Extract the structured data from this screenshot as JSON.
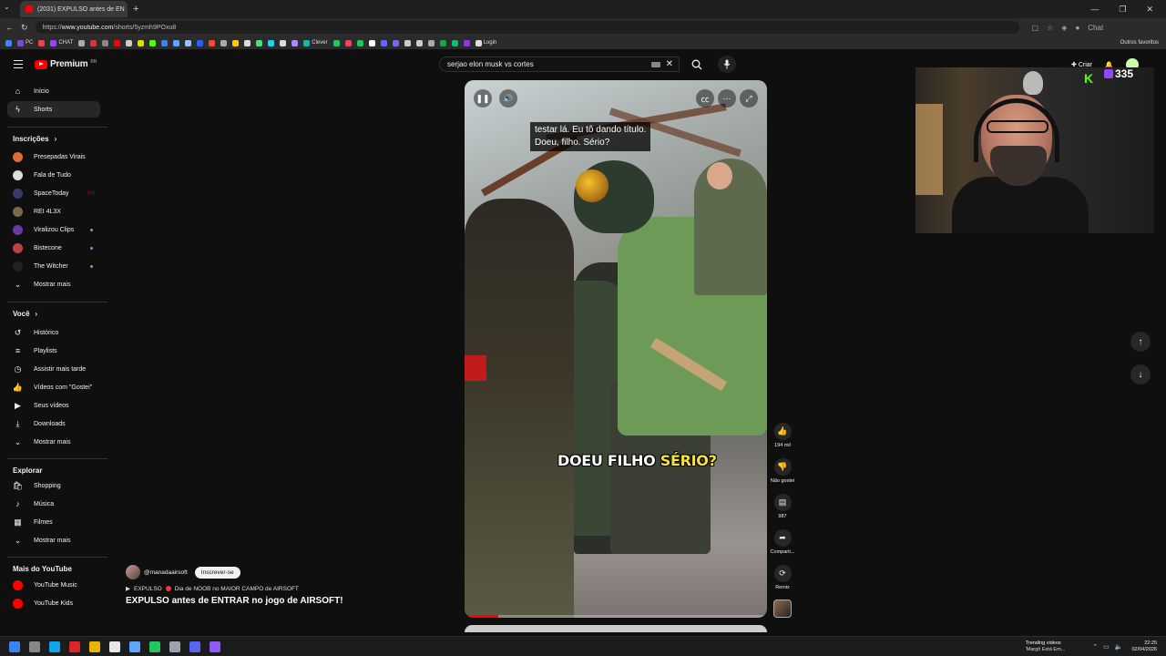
{
  "browser": {
    "tab_title": "(2031) EXPULSO antes de EN",
    "url_prefix": "https://",
    "url_host": "www.youtube.com",
    "url_path": "/shorts/5yzmh9POxu8",
    "bookmarks": [
      {
        "label": "",
        "color": "#4285f4"
      },
      {
        "label": "PC",
        "color": "#7b4bd6"
      },
      {
        "label": "",
        "color": "#e44"
      },
      {
        "label": "CHAT",
        "color": "#9146ff"
      },
      {
        "label": "",
        "color": "#aaa"
      },
      {
        "label": "",
        "color": "#d33"
      },
      {
        "label": "",
        "color": "#888"
      },
      {
        "label": "",
        "color": "#f00"
      },
      {
        "label": "",
        "color": "#ccc"
      },
      {
        "label": "",
        "color": "#dd0"
      },
      {
        "label": "",
        "color": "#53fc18"
      },
      {
        "label": "",
        "color": "#3b82f6"
      },
      {
        "label": "",
        "color": "#60a5fa"
      },
      {
        "label": "",
        "color": "#93c5fd"
      },
      {
        "label": "",
        "color": "#2563eb"
      },
      {
        "label": "",
        "color": "#f43"
      },
      {
        "label": "",
        "color": "#aaa"
      },
      {
        "label": "",
        "color": "#fc0"
      },
      {
        "label": "",
        "color": "#ddd"
      },
      {
        "label": "",
        "color": "#4ade80"
      },
      {
        "label": "",
        "color": "#22d3ee"
      },
      {
        "label": "",
        "color": "#ddd"
      },
      {
        "label": "",
        "color": "#a78bfa"
      },
      {
        "label": "Clever",
        "color": "#14b8a6"
      },
      {
        "label": "",
        "color": "#22c55e"
      },
      {
        "label": "",
        "color": "#f43f5e"
      },
      {
        "label": "",
        "color": "#22c55e"
      },
      {
        "label": "",
        "color": "#fff"
      },
      {
        "label": "",
        "color": "#6366f1"
      },
      {
        "label": "",
        "color": "#8b5cf6"
      },
      {
        "label": "",
        "color": "#ccc"
      },
      {
        "label": "",
        "color": "#ccc"
      },
      {
        "label": "",
        "color": "#aaa"
      },
      {
        "label": "",
        "color": "#16a34a"
      },
      {
        "label": "",
        "color": "#10b981"
      },
      {
        "label": "",
        "color": "#9333ea"
      },
      {
        "label": "Login",
        "color": "#ddd"
      }
    ],
    "bookmarks_right": "Outros favoritos",
    "chat_ext": "Chat"
  },
  "yt": {
    "logo_text": "Premium",
    "logo_country": "BR",
    "search_value": "serjao elon musk vs cortes",
    "create_label": "Criar",
    "notif_count": "9+"
  },
  "sidebar": {
    "main": [
      {
        "label": "Início",
        "icon": "home-icon",
        "glyph": "⌂"
      },
      {
        "label": "Shorts",
        "icon": "shorts-icon",
        "glyph": "ϟ"
      }
    ],
    "subscriptions_title": "Inscrições",
    "subscriptions": [
      {
        "label": "Presepadas Virais",
        "color": "#e06a3a",
        "badge": ""
      },
      {
        "label": "Fala de Tudo",
        "color": "#ddd",
        "badge": ""
      },
      {
        "label": "SpaceToday",
        "color": "#3a3a6a",
        "badge": "live"
      },
      {
        "label": "REI 4L3X",
        "color": "#7a6a4a",
        "badge": ""
      },
      {
        "label": "Viralizou Clips",
        "color": "#6a3aa0",
        "badge": "dot"
      },
      {
        "label": "Bistecone",
        "color": "#c0404a",
        "badge": "dot"
      },
      {
        "label": "The Witcher",
        "color": "#222",
        "badge": "dot"
      }
    ],
    "subs_more": "Mostrar mais",
    "you_title": "Você",
    "you": [
      {
        "label": "Histórico",
        "icon": "history-icon",
        "glyph": "↺"
      },
      {
        "label": "Playlists",
        "icon": "playlists-icon",
        "glyph": "≡"
      },
      {
        "label": "Assistir mais tarde",
        "icon": "watch-later-icon",
        "glyph": "◷"
      },
      {
        "label": "Vídeos com \"Gostei\"",
        "icon": "liked-videos-icon",
        "glyph": "👍"
      },
      {
        "label": "Seus vídeos",
        "icon": "your-videos-icon",
        "glyph": "▶"
      },
      {
        "label": "Downloads",
        "icon": "downloads-icon",
        "glyph": "⤓"
      }
    ],
    "you_more": "Mostrar mais",
    "explore_title": "Explorar",
    "explore": [
      {
        "label": "Shopping",
        "icon": "shopping-icon",
        "glyph": "🛍"
      },
      {
        "label": "Música",
        "icon": "music-icon",
        "glyph": "♪"
      },
      {
        "label": "Filmes",
        "icon": "movies-icon",
        "glyph": "▦"
      }
    ],
    "explore_more": "Mostrar mais",
    "more_title": "Mais do YouTube",
    "more": [
      {
        "label": "YouTube Music",
        "color": "#f00"
      },
      {
        "label": "YouTube Kids",
        "color": "#f00"
      }
    ]
  },
  "video": {
    "caption_line1": "testar lá. Eu tô dando título.",
    "caption_line2": "Doeu, filho. Sério?",
    "big_caption_white": "DOEU FILHO",
    "big_caption_yellow": "SÉRIO?",
    "progress": 0.11
  },
  "actions": {
    "like_count": "194 mil",
    "dislike_label": "Não gostei",
    "comments_count": "987",
    "share_label": "Comparti...",
    "remix_label": "Remix"
  },
  "meta": {
    "handle": "@manadaairsoft",
    "subscribe_label": "Inscrever-se",
    "playlist_line_a": "EXPULSO",
    "playlist_line_b": "Dia de NOOB no MAIOR CAMPO de AIRSOFT",
    "title": "EXPULSO antes de ENTRAR no jogo de AIRSOFT!"
  },
  "stream": {
    "viewers": "335"
  },
  "taskbar": {
    "news_title": "Trending videos",
    "news_sub": "'Margô Está Em...",
    "time": "22:25",
    "date": "02/04/2026"
  }
}
